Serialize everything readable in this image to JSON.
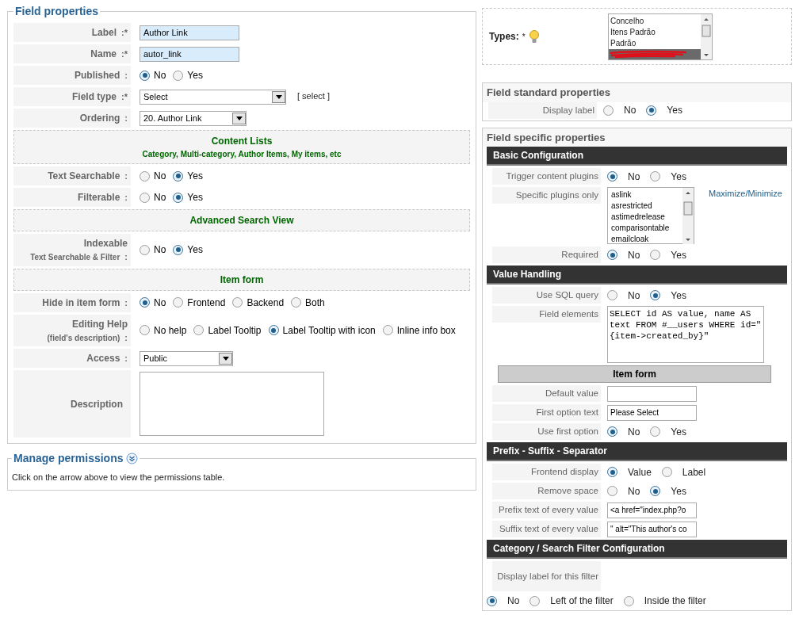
{
  "field_properties": {
    "title": "Field properties",
    "rows": [
      {
        "kind": "text",
        "label": "Label",
        "marker": ":*",
        "value": "Author Link"
      },
      {
        "kind": "text",
        "label": "Name",
        "marker": ":*",
        "value": "autor_link"
      },
      {
        "kind": "radio",
        "label": "Published",
        "marker": ":",
        "options": [
          {
            "label": "No",
            "selected": true
          },
          {
            "label": "Yes",
            "selected": false
          }
        ]
      },
      {
        "kind": "select",
        "label": "Field type",
        "marker": ":*",
        "value": "Select",
        "link": "[ select ]"
      },
      {
        "kind": "select",
        "label": "Ordering",
        "marker": ":",
        "value": "20. Author Link"
      },
      {
        "kind": "section",
        "title": "Content Lists",
        "subtitle": "Category, Multi-category, Author Items, My items, etc"
      },
      {
        "kind": "radio",
        "label": "Text Searchable",
        "marker": ":",
        "options": [
          {
            "label": "No",
            "selected": false
          },
          {
            "label": "Yes",
            "selected": true
          }
        ]
      },
      {
        "kind": "radio",
        "label": "Filterable",
        "marker": ":",
        "options": [
          {
            "label": "No",
            "selected": false
          },
          {
            "label": "Yes",
            "selected": true
          }
        ]
      },
      {
        "kind": "section",
        "title": "Advanced Search View"
      },
      {
        "kind": "radio",
        "label": "Indexable",
        "sublabel": "Text Searchable & Filter",
        "marker": ":",
        "options": [
          {
            "label": "No",
            "selected": false
          },
          {
            "label": "Yes",
            "selected": true
          }
        ]
      },
      {
        "kind": "section",
        "title": "Item form"
      },
      {
        "kind": "radio",
        "label": "Hide in item form",
        "marker": ":",
        "options": [
          {
            "label": "No",
            "selected": true
          },
          {
            "label": "Frontend",
            "selected": false
          },
          {
            "label": "Backend",
            "selected": false
          },
          {
            "label": "Both",
            "selected": false
          }
        ]
      },
      {
        "kind": "radio",
        "label": "Editing Help",
        "sublabel": "(field's description)",
        "marker": ":",
        "options": [
          {
            "label": "No help",
            "selected": false
          },
          {
            "label": "Label Tooltip",
            "selected": false
          },
          {
            "label": "Label Tooltip with icon",
            "selected": true
          },
          {
            "label": "Inline info box",
            "selected": false
          }
        ]
      },
      {
        "kind": "select",
        "label": "Access",
        "marker": ":",
        "value": "Public"
      },
      {
        "kind": "textarea",
        "label": "Description"
      }
    ]
  },
  "permissions": {
    "title": "Manage permissions",
    "note": "Click on the arrow above to view the permissions table."
  },
  "types": {
    "label": "Types:",
    "marker": "*",
    "items": [
      {
        "label": "Concelho",
        "selected": false,
        "redacted": false
      },
      {
        "label": "Itens Padrão",
        "selected": false,
        "redacted": false
      },
      {
        "label": "Padrão",
        "selected": false,
        "redacted": false
      },
      {
        "selected": true,
        "redacted": true
      }
    ]
  },
  "standard": {
    "title": "Field standard properties",
    "rows": [
      {
        "kind": "radio",
        "label": "Display label",
        "options": [
          {
            "label": "No",
            "selected": false
          },
          {
            "label": "Yes",
            "selected": true
          }
        ]
      }
    ]
  },
  "specific": {
    "title": "Field specific properties",
    "groups": [
      {
        "title": "Basic Configuration",
        "rows": [
          {
            "kind": "radio",
            "label": "Trigger content plugins",
            "options": [
              {
                "label": "No",
                "selected": true
              },
              {
                "label": "Yes",
                "selected": false
              }
            ]
          },
          {
            "kind": "list",
            "label": "Specific plugins only",
            "items": [
              "aslink",
              "asrestricted",
              "astimedrelease",
              "comparisontable",
              "emailcloak"
            ],
            "link": "Maximize/Minimize"
          },
          {
            "kind": "radio",
            "label": "Required",
            "options": [
              {
                "label": "No",
                "selected": true
              },
              {
                "label": "Yes",
                "selected": false
              }
            ]
          }
        ]
      },
      {
        "title": "Value Handling",
        "rows": [
          {
            "kind": "radio",
            "label": "Use SQL query",
            "options": [
              {
                "label": "No",
                "selected": false
              },
              {
                "label": "Yes",
                "selected": true
              }
            ]
          },
          {
            "kind": "code",
            "label": "Field elements",
            "value": "SELECT id AS value, name AS text FROM #__users WHERE id=\"{item->created_by}\""
          },
          {
            "kind": "subheader",
            "title": "Item form"
          },
          {
            "kind": "input",
            "label": "Default value"
          },
          {
            "kind": "input",
            "label": "First option text",
            "value": "Please Select"
          },
          {
            "kind": "radio",
            "label": "Use first option",
            "options": [
              {
                "label": "No",
                "selected": true
              },
              {
                "label": "Yes",
                "selected": false
              }
            ]
          }
        ]
      },
      {
        "title": "Prefix - Suffix - Separator",
        "rows": [
          {
            "kind": "radio",
            "label": "Frontend display",
            "options": [
              {
                "label": "Value",
                "selected": true
              },
              {
                "label": "Label",
                "selected": false
              }
            ]
          },
          {
            "kind": "radio",
            "label": "Remove space",
            "options": [
              {
                "label": "No",
                "selected": false
              },
              {
                "label": "Yes",
                "selected": true
              }
            ]
          },
          {
            "kind": "input",
            "label": "Prefix text of every value",
            "value": "<a href=\"index.php?o"
          },
          {
            "kind": "input",
            "label": "Suffix text of every value",
            "value": "\" alt=\"This author's co"
          }
        ]
      },
      {
        "title": "Category / Search Filter Configuration",
        "rows": [
          {
            "kind": "radio_below",
            "label": "Display label for this filter",
            "options": [
              {
                "label": "No",
                "selected": true
              },
              {
                "label": "Left of the filter",
                "selected": false
              },
              {
                "label": "Inside the filter",
                "selected": false
              }
            ]
          }
        ]
      }
    ]
  }
}
